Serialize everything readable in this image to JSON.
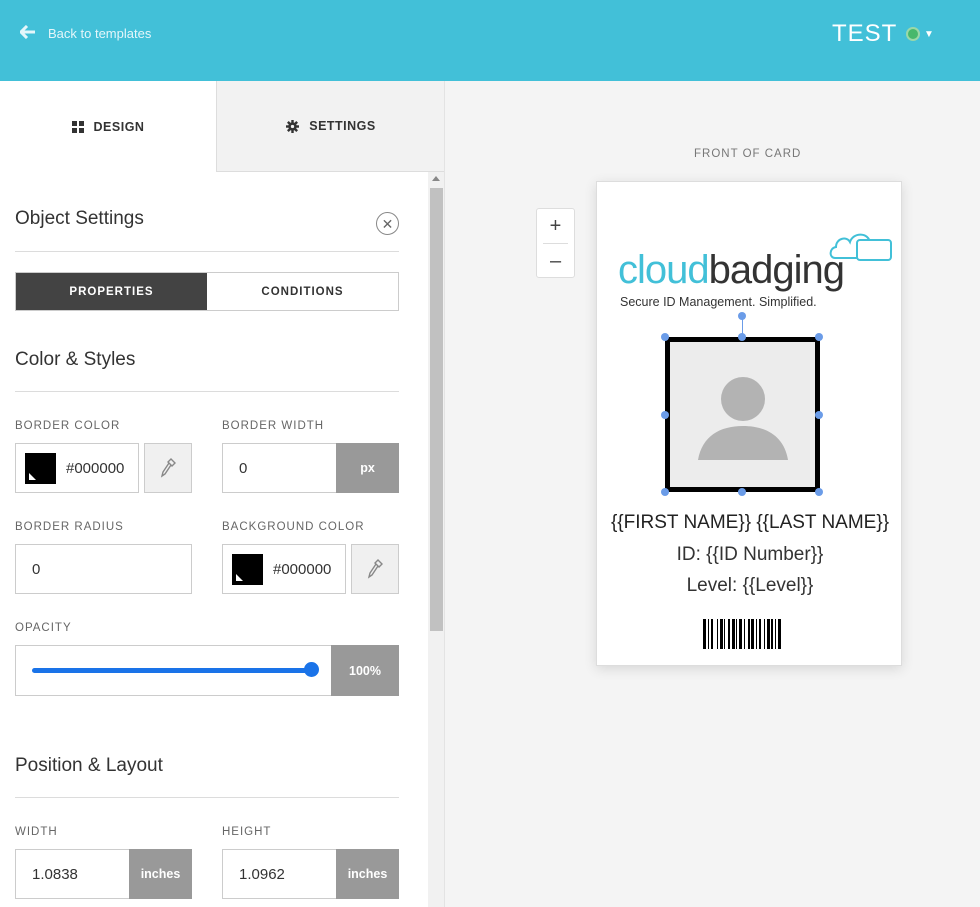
{
  "header": {
    "back_label": "Back to templates",
    "title": "TEST",
    "status_color": "#47b86c",
    "accent": "#42c0d8"
  },
  "tabs": [
    {
      "label": "DESIGN",
      "icon": "grid-icon",
      "active": true
    },
    {
      "label": "SETTINGS",
      "icon": "gear-icon",
      "active": false
    }
  ],
  "object_settings": {
    "title": "Object Settings",
    "segments": {
      "properties": "PROPERTIES",
      "conditions": "CONDITIONS",
      "active": "PROPERTIES"
    },
    "color_styles": {
      "title": "Color & Styles",
      "border_color_label": "BORDER COLOR",
      "border_color_value": "#000000",
      "border_width_label": "BORDER WIDTH",
      "border_width_value": "0",
      "border_width_unit": "px",
      "border_radius_label": "BORDER RADIUS",
      "border_radius_value": "0",
      "background_color_label": "BACKGROUND COLOR",
      "background_color_value": "#000000",
      "opacity_label": "OPACITY",
      "opacity_value": "100%",
      "opacity_level": 1.0
    },
    "position_layout": {
      "title": "Position & Layout",
      "width_label": "WIDTH",
      "width_value": "1.0838",
      "width_unit": "inches",
      "height_label": "HEIGHT",
      "height_value": "1.0962",
      "height_unit": "inches"
    }
  },
  "canvas": {
    "side_label": "FRONT OF CARD",
    "zoom_in": "+",
    "zoom_out": "–",
    "card": {
      "logo_part1": "cloud",
      "logo_part2": "badging",
      "tagline": "Secure ID Management. Simplified.",
      "name_line": "{{FIRST NAME}} {{LAST NAME}}",
      "id_line": "ID: {{ID Number}}",
      "level_line": "Level: {{Level}}"
    }
  }
}
